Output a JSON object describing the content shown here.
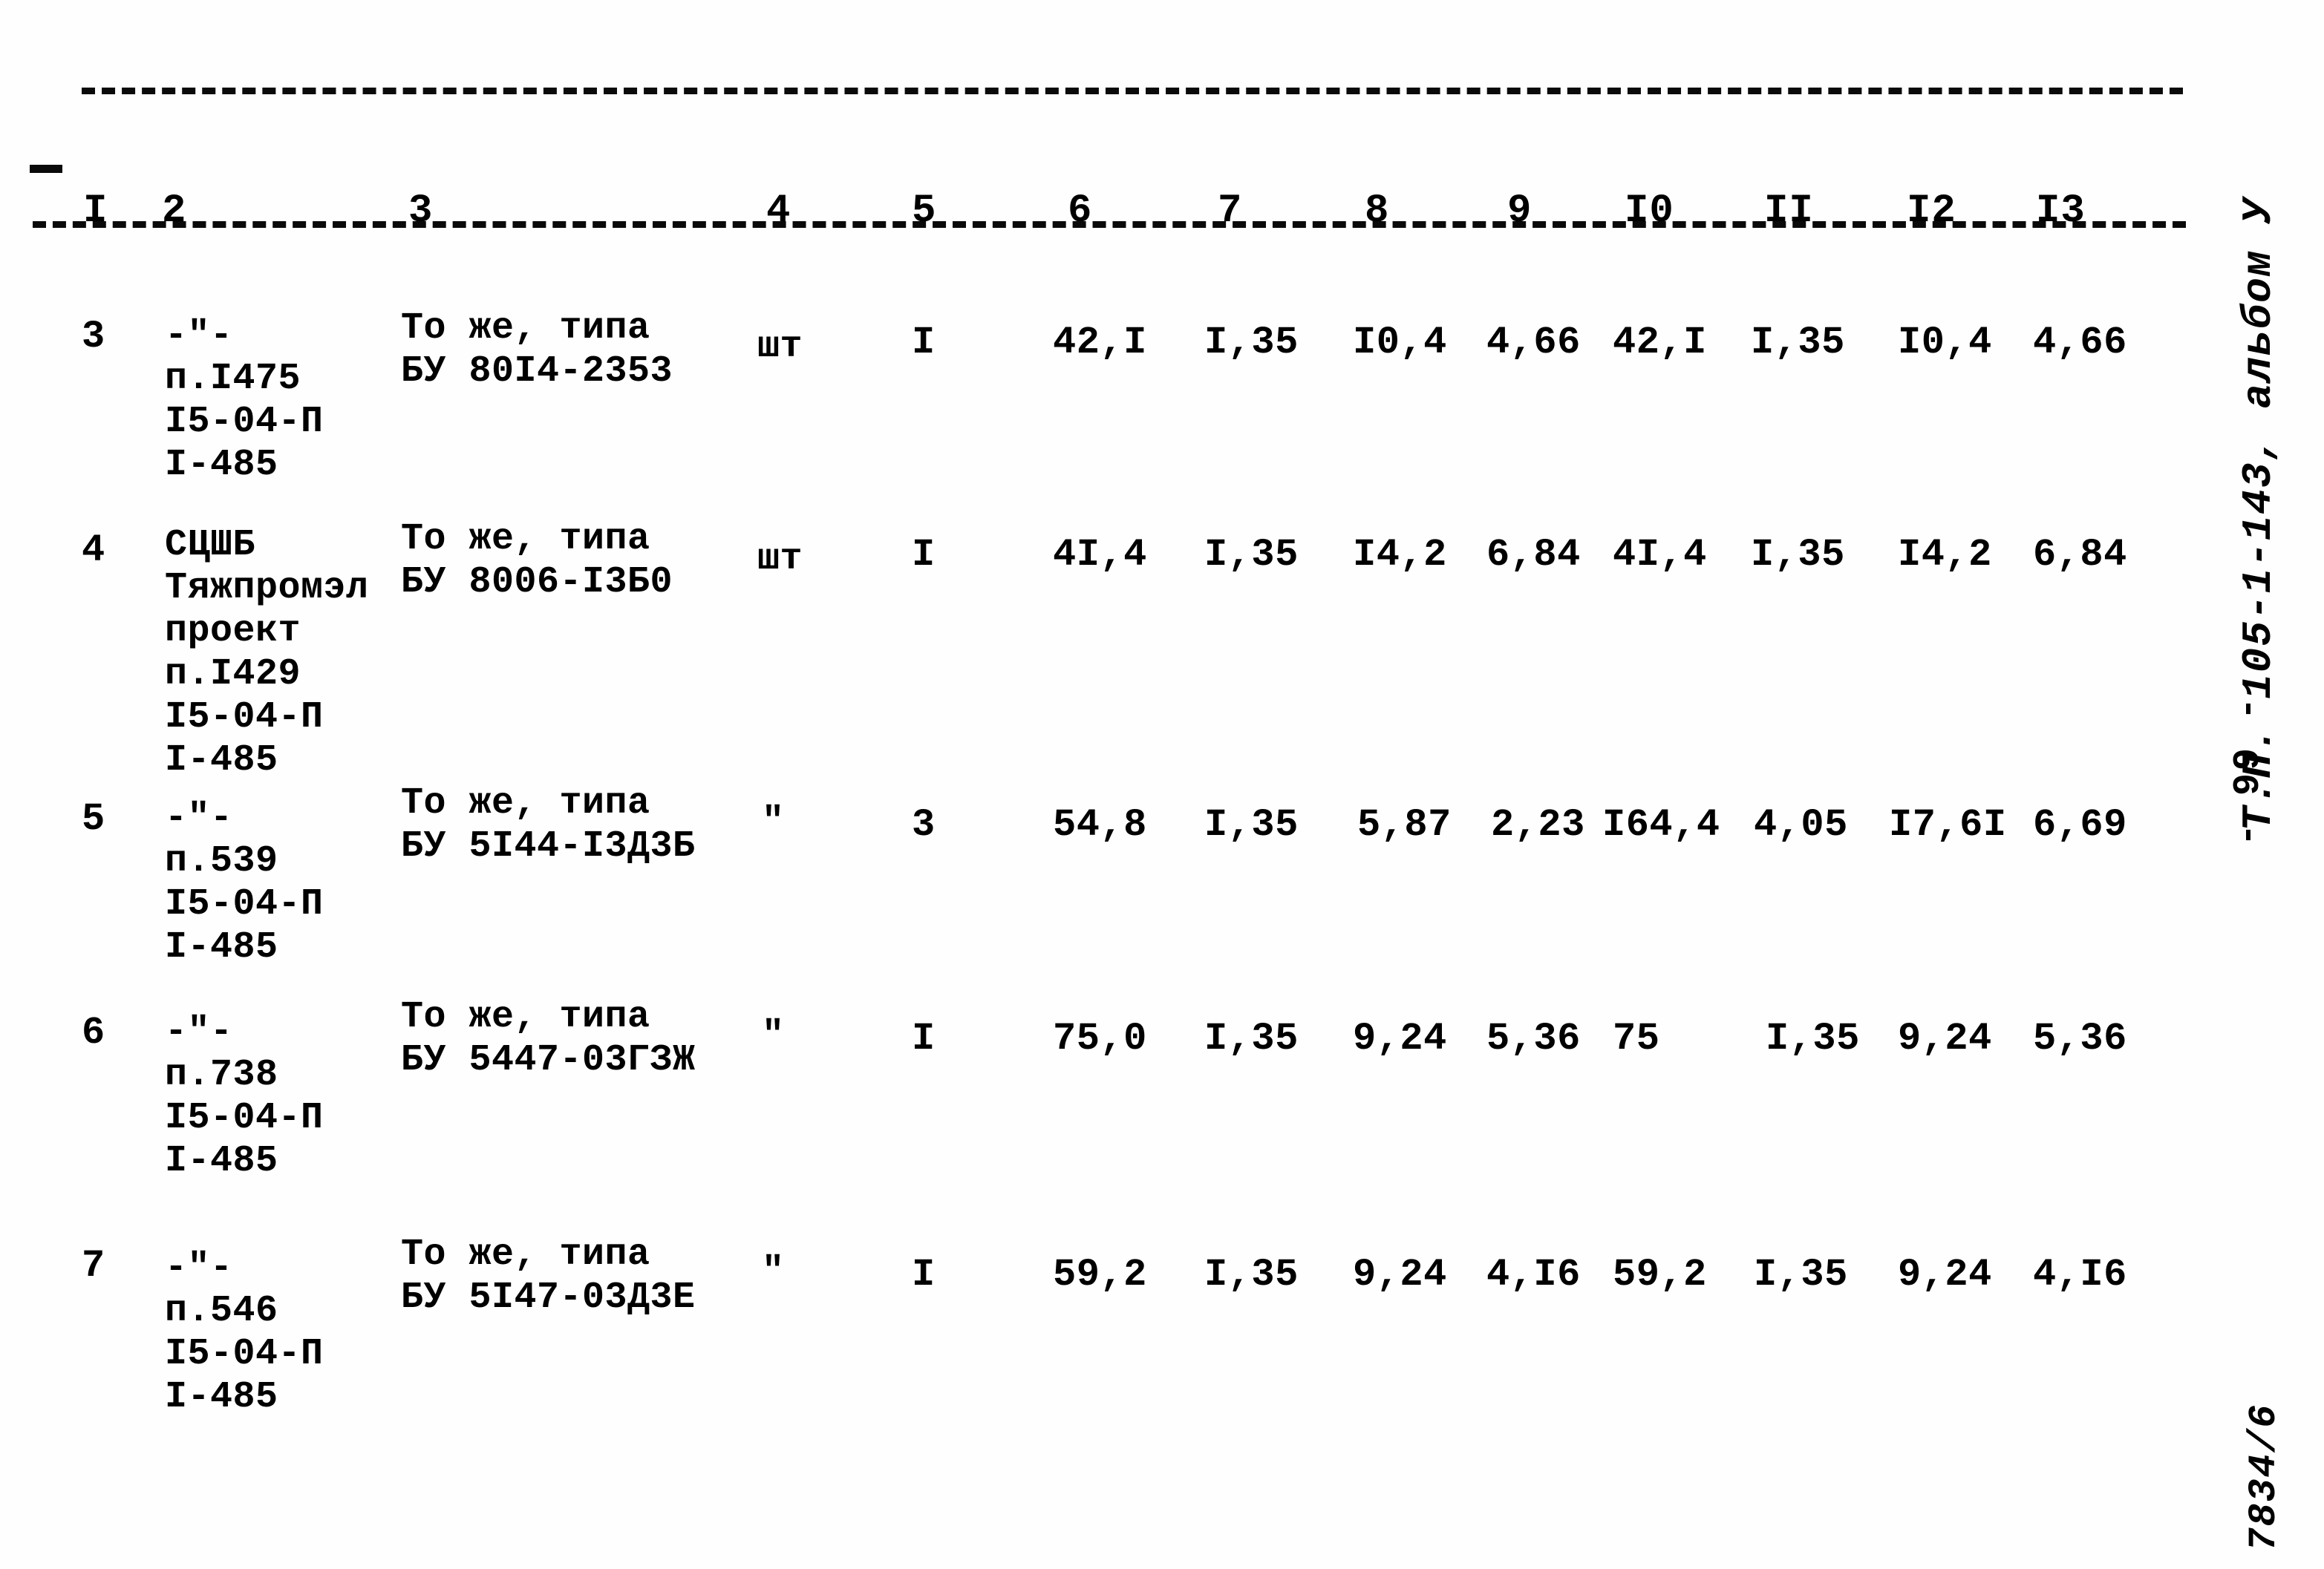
{
  "document": {
    "margin_title": "Т.П. 105-1-143, альбом У",
    "page_marker": "- 99 -",
    "corner_stamp": "7834/6"
  },
  "table": {
    "column_headers": [
      "I",
      "2",
      "3",
      "4",
      "5",
      "6",
      "7",
      "8",
      "9",
      "I0",
      "II",
      "I2",
      "I3"
    ],
    "rows": [
      {
        "c1": "3",
        "c2": "-\"-\nп.I475\nI5-04-П\nI-485",
        "c3": "То же, типа\nБУ 80I4-2353",
        "c4": "шт",
        "c5": "I",
        "c6": "42,I",
        "c7": "I,35",
        "c8": "I0,4",
        "c9": "4,66",
        "c10": "42,I",
        "c11": "I,35",
        "c12": "I0,4",
        "c13": "4,66"
      },
      {
        "c1": "4",
        "c2": "СЦШБ\nТяжпромэл\nпроект\nп.I429\nI5-04-П\nI-485",
        "c3": "То же, типа\nБУ 8006-I3Б0",
        "c4": "шт",
        "c5": "I",
        "c6": "4I,4",
        "c7": "I,35",
        "c8": "I4,2",
        "c9": "6,84",
        "c10": "4I,4",
        "c11": "I,35",
        "c12": "I4,2",
        "c13": "6,84"
      },
      {
        "c1": "5",
        "c2": "-\"-\nп.539\nI5-04-П\nI-485",
        "c3": "То же, типа\nБУ 5I44-I3Д3Б",
        "c4": "\"",
        "c5": "3",
        "c6": "54,8",
        "c7": "I,35",
        "c8": "5,87",
        "c9": "2,23",
        "c10": "I64,4",
        "c11": "4,05",
        "c12": "I7,6I",
        "c13": "6,69"
      },
      {
        "c1": "6",
        "c2": "-\"-\nп.738\nI5-04-П\nI-485",
        "c3": "То же, типа\nБУ 5447-03ГЗЖ",
        "c4": "\"",
        "c5": "I",
        "c6": "75,0",
        "c7": "I,35",
        "c8": "9,24",
        "c9": "5,36",
        "c10": "75",
        "c11": "I,35",
        "c12": "9,24",
        "c13": "5,36"
      },
      {
        "c1": "7",
        "c2": "-\"-\nп.546\nI5-04-П\nI-485",
        "c3": "То же, типа\nБУ 5I47-03Д3Е",
        "c4": "\"",
        "c5": "I",
        "c6": "59,2",
        "c7": "I,35",
        "c8": "9,24",
        "c9": "4,I6",
        "c10": "59,2",
        "c11": "I,35",
        "c12": "9,24",
        "c13": "4,I6"
      }
    ]
  }
}
